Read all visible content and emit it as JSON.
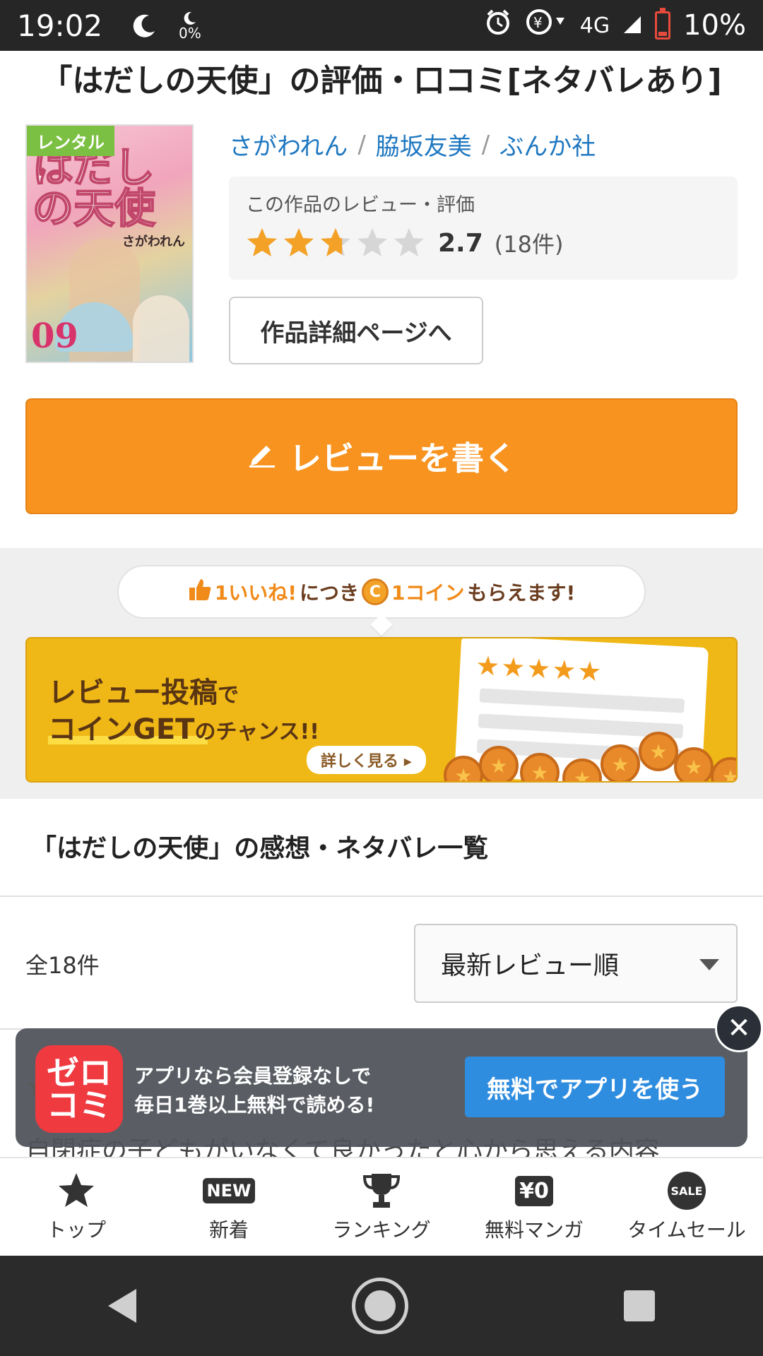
{
  "status_bar": {
    "time": "19:02",
    "data_percent": "0%",
    "network": "4G",
    "battery": "10%"
  },
  "page_title": "「はだしの天使」の評価・口コミ[ネタバレあり]",
  "book": {
    "rental_badge": "レンタル",
    "cover_title": "はだしの天使",
    "cover_author": "さがわれん",
    "cover_volume": "09",
    "authors": [
      "さがわれん",
      "脇坂友美",
      "ぶんか社"
    ],
    "separator": "/"
  },
  "rating": {
    "label": "この作品のレビュー・評価",
    "score": "2.7",
    "count": "(18件)",
    "stars_value": 2.7,
    "stars_max": 5,
    "star_color": "#f3a227",
    "star_empty_color": "#d6d6d6"
  },
  "detail_button": "作品詳細ページへ",
  "write_button": "レビューを書く",
  "promo": {
    "bubble_part1": "1いいね!",
    "bubble_part2": "につき",
    "coin_letter": "C",
    "bubble_part3": "1コイン",
    "bubble_part4": "もらえます!",
    "banner_line1": "レビュー投稿",
    "banner_line1_suffix": "で",
    "banner_line2": "コインGET",
    "banner_line2_suffix": "のチャンス!!",
    "banner_more": "詳しく見る"
  },
  "list": {
    "title": "「はだしの天使」の感想・ネタバレ一覧",
    "count": "全18件",
    "sort_selected": "最新レビュー順"
  },
  "peek_text": "自閉症の子どもがいなくて良かったと心から思える内容",
  "app_banner": {
    "icon_line1": "ゼロ",
    "icon_line2": "コミ",
    "text_line1": "アプリなら会員登録なしで",
    "text_line2": "毎日1巻以上無料で読める!",
    "button": "無料でアプリを使う"
  },
  "bottom_nav": [
    {
      "label": "トップ",
      "icon": "star-icon"
    },
    {
      "label": "新着",
      "icon": "new-icon",
      "badge": "NEW"
    },
    {
      "label": "ランキング",
      "icon": "trophy-icon"
    },
    {
      "label": "無料マンガ",
      "icon": "free-icon",
      "badge": "¥0"
    },
    {
      "label": "タイムセール",
      "icon": "sale-icon",
      "badge": "SALE"
    }
  ],
  "colors": {
    "accent_orange": "#f7931e",
    "link_blue": "#1f78c1",
    "banner_yellow": "#f0b816",
    "app_button_blue": "#2f8ddf"
  }
}
